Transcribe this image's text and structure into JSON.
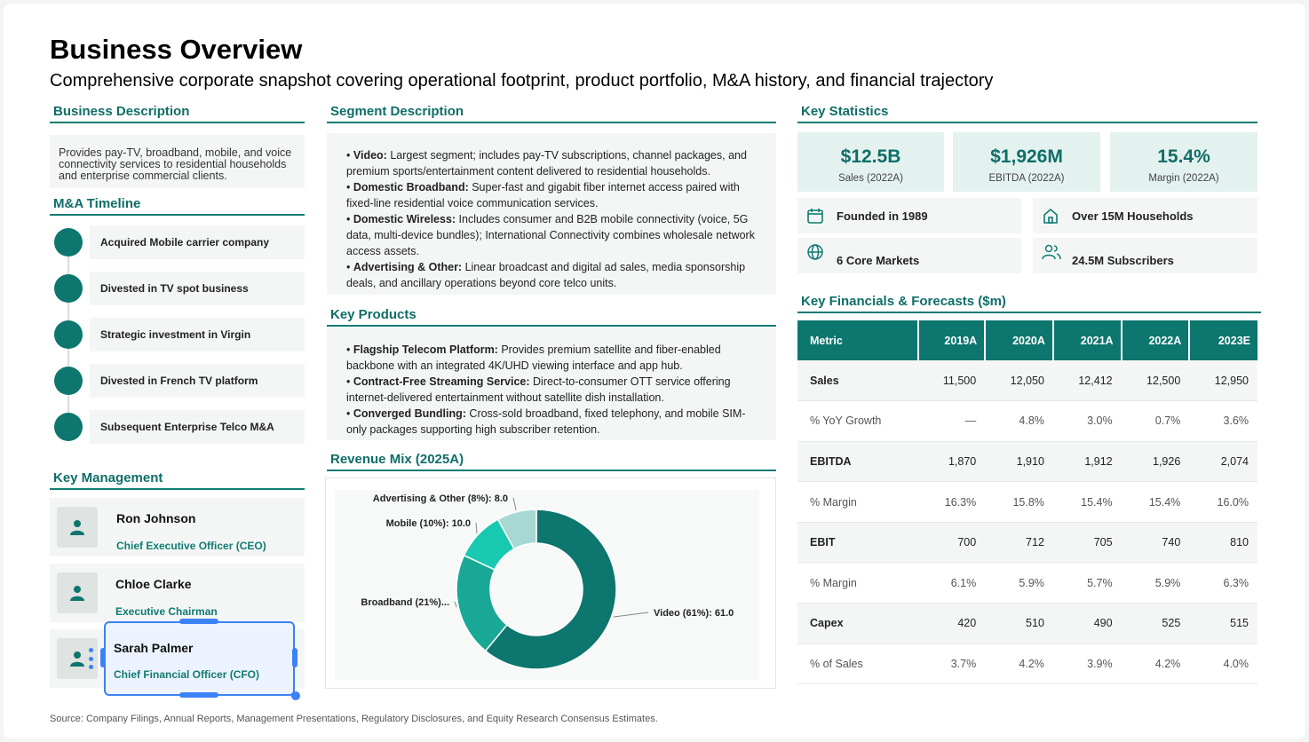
{
  "header": {
    "title": "Business Overview",
    "subtitle": "Comprehensive corporate snapshot covering operational footprint, product portfolio, M&A history, and financial trajectory"
  },
  "business_description": {
    "heading": "Business Description",
    "text": "Provides pay-TV, broadband, mobile, and voice connectivity services to residential households and enterprise commercial clients."
  },
  "ma_timeline": {
    "heading": "M&A Timeline",
    "items": [
      "Acquired Mobile carrier company",
      "Divested in TV spot business",
      "Strategic investment in Virgin",
      "Divested in French TV platform",
      "Subsequent Enterprise Telco M&A"
    ]
  },
  "key_management": {
    "heading": "Key Management",
    "people": [
      {
        "name": "Ron Johnson",
        "role": "Chief Executive Officer (CEO)"
      },
      {
        "name": "Chloe Clarke",
        "role": "Executive Chairman"
      },
      {
        "name": "Sarah Palmer",
        "role": "Chief Financial Officer (CFO)"
      }
    ]
  },
  "segment_description": {
    "heading": "Segment Description",
    "items": [
      {
        "label": "Video:",
        "text": " Largest segment; includes pay-TV subscriptions, channel packages, and premium sports/entertainment content delivered to residential households."
      },
      {
        "label": "Domestic Broadband:",
        "text": " Super-fast and gigabit fiber internet access paired with fixed-line residential voice communication services."
      },
      {
        "label": "Domestic Wireless:",
        "text": " Includes consumer and B2B mobile connectivity (voice, 5G data, multi-device bundles); International Connectivity combines wholesale network access assets."
      },
      {
        "label": "Advertising & Other:",
        "text": " Linear broadcast and digital ad sales, media sponsorship deals, and ancillary operations beyond core telco units."
      }
    ]
  },
  "key_products": {
    "heading": "Key Products",
    "items": [
      {
        "label": "Flagship Telecom Platform:",
        "text": " Provides premium satellite and fiber-enabled backbone with an integrated 4K/UHD viewing interface and app hub."
      },
      {
        "label": "Contract-Free Streaming Service:",
        "text": " Direct-to-consumer OTT service offering internet-delivered entertainment without satellite dish installation."
      },
      {
        "label": "Converged Bundling:",
        "text": " Cross-sold broadband, fixed telephony, and mobile SIM-only packages supporting high subscriber retention."
      }
    ]
  },
  "revenue_mix": {
    "heading": "Revenue Mix (2025A)"
  },
  "chart_data": {
    "type": "pie",
    "title": "Revenue Mix (2025A)",
    "donut": true,
    "series": [
      {
        "label": "Video (61%): 61.0",
        "value": 61.0,
        "color": "#0d766e"
      },
      {
        "label": "Broadband (21%)...",
        "value": 21.0,
        "color": "#1aa896"
      },
      {
        "label": "Mobile (10%): 10.0",
        "value": 10.0,
        "color": "#18c9b0"
      },
      {
        "label": "Advertising & Other (8%): 8.0",
        "value": 8.0,
        "color": "#a8d8d2"
      }
    ]
  },
  "key_statistics": {
    "heading": "Key Statistics",
    "stats": [
      {
        "value": "$12.5B",
        "label": "Sales (2022A)"
      },
      {
        "value": "$1,926M",
        "label": "EBITDA (2022A)"
      },
      {
        "value": "15.4%",
        "label": "Margin (2022A)"
      }
    ],
    "facts": [
      {
        "icon": "calendar-icon",
        "text": "Founded in 1989"
      },
      {
        "icon": "home-icon",
        "text": "Over 15M Households"
      },
      {
        "icon": "globe-icon",
        "text": "6 Core Markets"
      },
      {
        "icon": "users-icon",
        "text": "24.5M Subscribers"
      }
    ]
  },
  "financials": {
    "heading": "Key Financials & Forecasts ($m)",
    "columns": [
      "Metric",
      "2019A",
      "2020A",
      "2021A",
      "2022A",
      "2023E"
    ],
    "rows": [
      {
        "cells": [
          "Sales",
          "11,500",
          "12,050",
          "12,412",
          "12,500",
          "12,950"
        ],
        "bold": true
      },
      {
        "cells": [
          "% YoY Growth",
          "—",
          "4.8%",
          "3.0%",
          "0.7%",
          "3.6%"
        ],
        "bold": false
      },
      {
        "cells": [
          "EBITDA",
          "1,870",
          "1,910",
          "1,912",
          "1,926",
          "2,074"
        ],
        "bold": true
      },
      {
        "cells": [
          "% Margin",
          "16.3%",
          "15.8%",
          "15.4%",
          "15.4%",
          "16.0%"
        ],
        "bold": false
      },
      {
        "cells": [
          "EBIT",
          "700",
          "712",
          "705",
          "740",
          "810"
        ],
        "bold": true
      },
      {
        "cells": [
          "% Margin",
          "6.1%",
          "5.9%",
          "5.7%",
          "5.9%",
          "6.3%"
        ],
        "bold": false
      },
      {
        "cells": [
          "Capex",
          "420",
          "510",
          "490",
          "525",
          "515"
        ],
        "bold": true
      },
      {
        "cells": [
          "% of Sales",
          "3.7%",
          "4.2%",
          "3.9%",
          "4.2%",
          "4.0%"
        ],
        "bold": false
      }
    ]
  },
  "footer": {
    "source": "Source: Company Filings, Annual Reports, Management Presentations, Regulatory Disclosures, and Equity Research Consensus Estimates."
  }
}
